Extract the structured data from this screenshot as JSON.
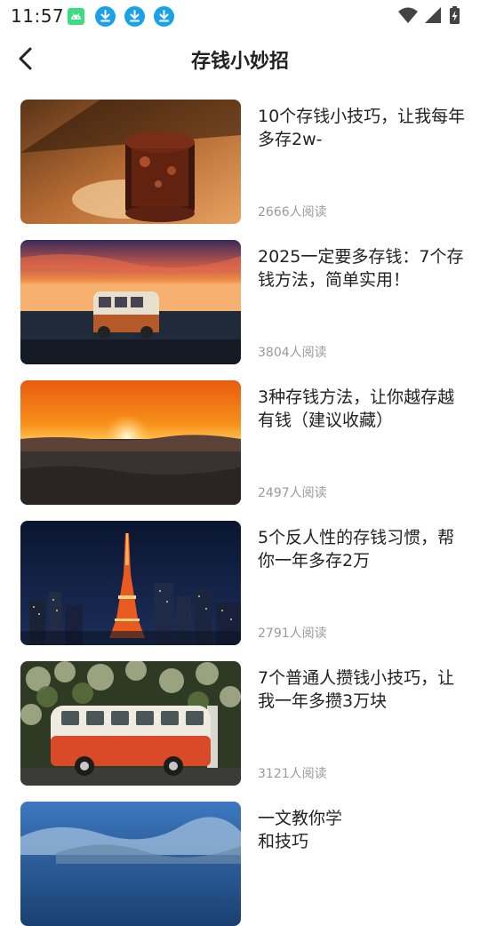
{
  "status_bar": {
    "time": "11:57",
    "icons": [
      "android-icon",
      "download-icon",
      "download-icon",
      "download-icon",
      "wifi-icon",
      "signal-icon",
      "battery-charging-icon"
    ]
  },
  "header": {
    "back_icon": "chevron-left-icon",
    "title": "存钱小妙招"
  },
  "articles": [
    {
      "title": "10个存钱小技巧，让我每年多存2w-",
      "reads": "2666人阅读",
      "image": "glass-of-iced-drink"
    },
    {
      "title": "2025一定要多存钱：7个存钱方法，简单实用！",
      "reads": "3804人阅读",
      "image": "van-at-sunset-by-sea"
    },
    {
      "title": "3种存钱方法，让你越存越有钱（建议收藏）",
      "reads": "2497人阅读",
      "image": "sunset-over-clouds"
    },
    {
      "title": "5个反人性的存钱习惯，帮你一年多存2万",
      "reads": "2791人阅读",
      "image": "tokyo-tower-at-night"
    },
    {
      "title": "7个普通人攒钱小技巧，让我一年多攒3万块",
      "reads": "3121人阅读",
      "image": "red-vintage-bus"
    },
    {
      "title": "一文教你学\n和技巧",
      "reads": "",
      "image": "blue-sky-clouds"
    }
  ],
  "colors": {
    "accent_download": "#1ba1e8",
    "android": "#3ddc84",
    "reads_text": "#9a9a9a"
  }
}
